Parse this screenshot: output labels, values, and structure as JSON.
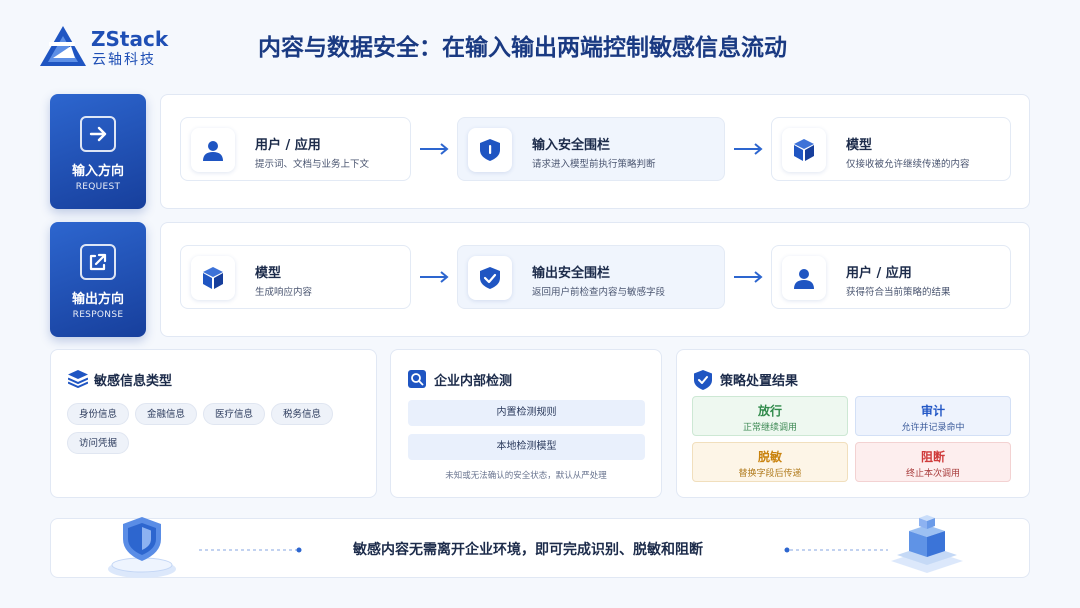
{
  "brand": {
    "name": "ZStack",
    "name_cn": "云轴科技"
  },
  "title": "内容与数据安全：在输入输出两端控制敏感信息流动",
  "request": {
    "label": "输入方向",
    "sub": "REQUEST",
    "steps": [
      {
        "title": "用户 / 应用",
        "desc": "提示词、文档与业务上下文",
        "icon": "user-icon"
      },
      {
        "title": "输入安全围栏",
        "desc": "请求进入模型前执行策略判断",
        "icon": "shield-icon"
      },
      {
        "title": "模型",
        "desc": "仅接收被允许继续传递的内容",
        "icon": "cube-icon"
      }
    ]
  },
  "response": {
    "label": "输出方向",
    "sub": "RESPONSE",
    "steps": [
      {
        "title": "模型",
        "desc": "生成响应内容",
        "icon": "cube-icon"
      },
      {
        "title": "输出安全围栏",
        "desc": "返回用户前检查内容与敏感字段",
        "icon": "shield-check-icon"
      },
      {
        "title": "用户 / 应用",
        "desc": "获得符合当前策略的结果",
        "icon": "user-icon"
      }
    ]
  },
  "sensitive": {
    "title": "敏感信息类型",
    "chips": [
      "身份信息",
      "金融信息",
      "医疗信息",
      "税务信息",
      "访问凭据"
    ]
  },
  "detection": {
    "title": "企业内部检测",
    "items": [
      "内置检测规则",
      "本地检测模型"
    ],
    "note": "未知或无法确认的安全状态，默认从严处理"
  },
  "policy": {
    "title": "策略处置结果",
    "results": [
      {
        "title": "放行",
        "desc": "正常继续调用",
        "color": "#2f8a4a"
      },
      {
        "title": "审计",
        "desc": "允许并记录命中",
        "color": "#2458c6"
      },
      {
        "title": "脱敏",
        "desc": "替换字段后传递",
        "color": "#c9820d"
      },
      {
        "title": "阻断",
        "desc": "终止本次调用",
        "color": "#cf3a3a"
      }
    ]
  },
  "footer": {
    "text": "敏感内容无需离开企业环境，即可完成识别、脱敏和阻断"
  },
  "colors": {
    "primary": "#1f4fb5",
    "accent": "#2d66cf"
  }
}
